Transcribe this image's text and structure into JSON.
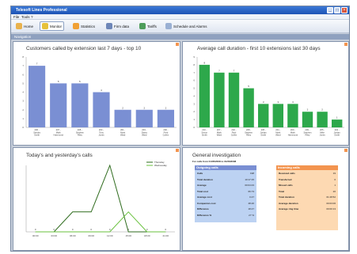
{
  "window": {
    "title": "Telesoft Lines Professional"
  },
  "menu": {
    "items": [
      "File",
      "Tools",
      "?"
    ]
  },
  "toolbar": {
    "buttons": [
      {
        "label": "Home",
        "icon": "home-icon"
      },
      {
        "label": "Monitor",
        "icon": "monitor-icon"
      },
      {
        "label": "Statistics",
        "icon": "statistics-icon"
      },
      {
        "label": "Firm data",
        "icon": "firm-data-icon"
      },
      {
        "label": "Tariffs",
        "icon": "tariffs-icon"
      },
      {
        "label": "Schedule and Alarms",
        "icon": "schedule-alarms-icon"
      }
    ],
    "active": "Monitor"
  },
  "location": "Navigation",
  "colors": {
    "accent_blue": "#7a8fd3",
    "accent_green": "#2da84b",
    "accent_orange": "#f3944f",
    "light_blue": "#bcd2f2",
    "light_orange": "#fdd9b2"
  },
  "panels": {
    "top_10_extensions": {
      "title": "Customers called by extension last 7 days - top 10",
      "chart_data": {
        "type": "bar",
        "categories": [
          "206 - Sandra Smith",
          "207 - Mark Hammond",
          "208 - Stephen Riley",
          "203 - Tony Jones",
          "201 - Mark Ward",
          "203 - Diana Ward",
          "200 - Fred Cullen"
        ],
        "values": [
          7,
          5,
          5,
          4,
          2,
          2,
          2
        ],
        "ylim": [
          0,
          8
        ],
        "yticks": [
          "0",
          "1",
          "2",
          "3",
          "4",
          "5",
          "6",
          "7",
          "8"
        ],
        "grid": false,
        "color": "#7a8fd3"
      }
    },
    "avg_call_duration": {
      "title": "Average call duration - first 10 extensions last 30 days",
      "chart_data": {
        "type": "bar",
        "categories": [
          "210 - Simon Smith",
          "207 - Mark Ward",
          "202 - Paul Cullen",
          "208 - Stephen Riley",
          "205 - Jordan Smith",
          "201 - Mark Ward",
          "200 - Mark Hammond",
          "209 - Stephen Riley",
          "205 - Mike Jones",
          "202 - Jordan Smith"
        ],
        "values": [
          8,
          7,
          7,
          5,
          3,
          3,
          3,
          2,
          2,
          1
        ],
        "ylim": [
          0,
          9
        ],
        "yticks": [
          "0",
          "1",
          "2",
          "3",
          "4",
          "5",
          "6",
          "7",
          "8",
          "9"
        ],
        "grid": false,
        "color": "#2da84b"
      }
    },
    "today_yesterday": {
      "title": "Today's and yesterday's calls",
      "chart_data": {
        "type": "line",
        "x": [
          "00:00",
          "03:00",
          "06:00",
          "09:00",
          "12:00",
          "15:00",
          "18:00",
          "21:00"
        ],
        "ylim": [
          0,
          10
        ],
        "series": [
          {
            "name": "Thursday",
            "values": [
              0,
              0,
              3,
              3,
              10,
              0,
              0,
              0
            ],
            "color": "#2e6b1d"
          },
          {
            "name": "Wednesday",
            "values": [
              0,
              0,
              0,
              0,
              0,
              3,
              0,
              0
            ],
            "color": "#69c13d"
          }
        ],
        "value_labels": [
          "0",
          "0",
          "0",
          "0",
          "0",
          "0",
          "0",
          "0"
        ],
        "legend": "top-right",
        "grid": false
      }
    },
    "general_investigation": {
      "title": "General investigation",
      "period": "For calls from 01/05/2008 to 01/06/2008",
      "outgoing": {
        "header": "Outgoing calls",
        "rows": [
          {
            "label": "Calls",
            "value": "198"
          },
          {
            "label": "Total duration",
            "value": "10:17:15"
          },
          {
            "label": "Average",
            "value": "00:04:23"
          },
          {
            "label": "Total cost",
            "value": "66.73"
          },
          {
            "label": "Average cost",
            "value": "0.47"
          },
          {
            "label": "Companion cost",
            "value": "48.26"
          },
          {
            "label": "Difference",
            "value": "18.47"
          },
          {
            "label": "Difference %",
            "value": "27 %"
          }
        ]
      },
      "incoming": {
        "header": "Incoming calls",
        "rows": [
          {
            "label": "Received calls",
            "value": "19"
          },
          {
            "label": "Transferred",
            "value": "0"
          },
          {
            "label": "Missed calls",
            "value": "1"
          },
          {
            "label": "Total",
            "value": "20"
          },
          {
            "label": "Total duration",
            "value": "01:28:52"
          },
          {
            "label": "Average duration",
            "value": "00:03:06"
          },
          {
            "label": "Average ring time",
            "value": "00:00:13"
          }
        ]
      }
    }
  }
}
